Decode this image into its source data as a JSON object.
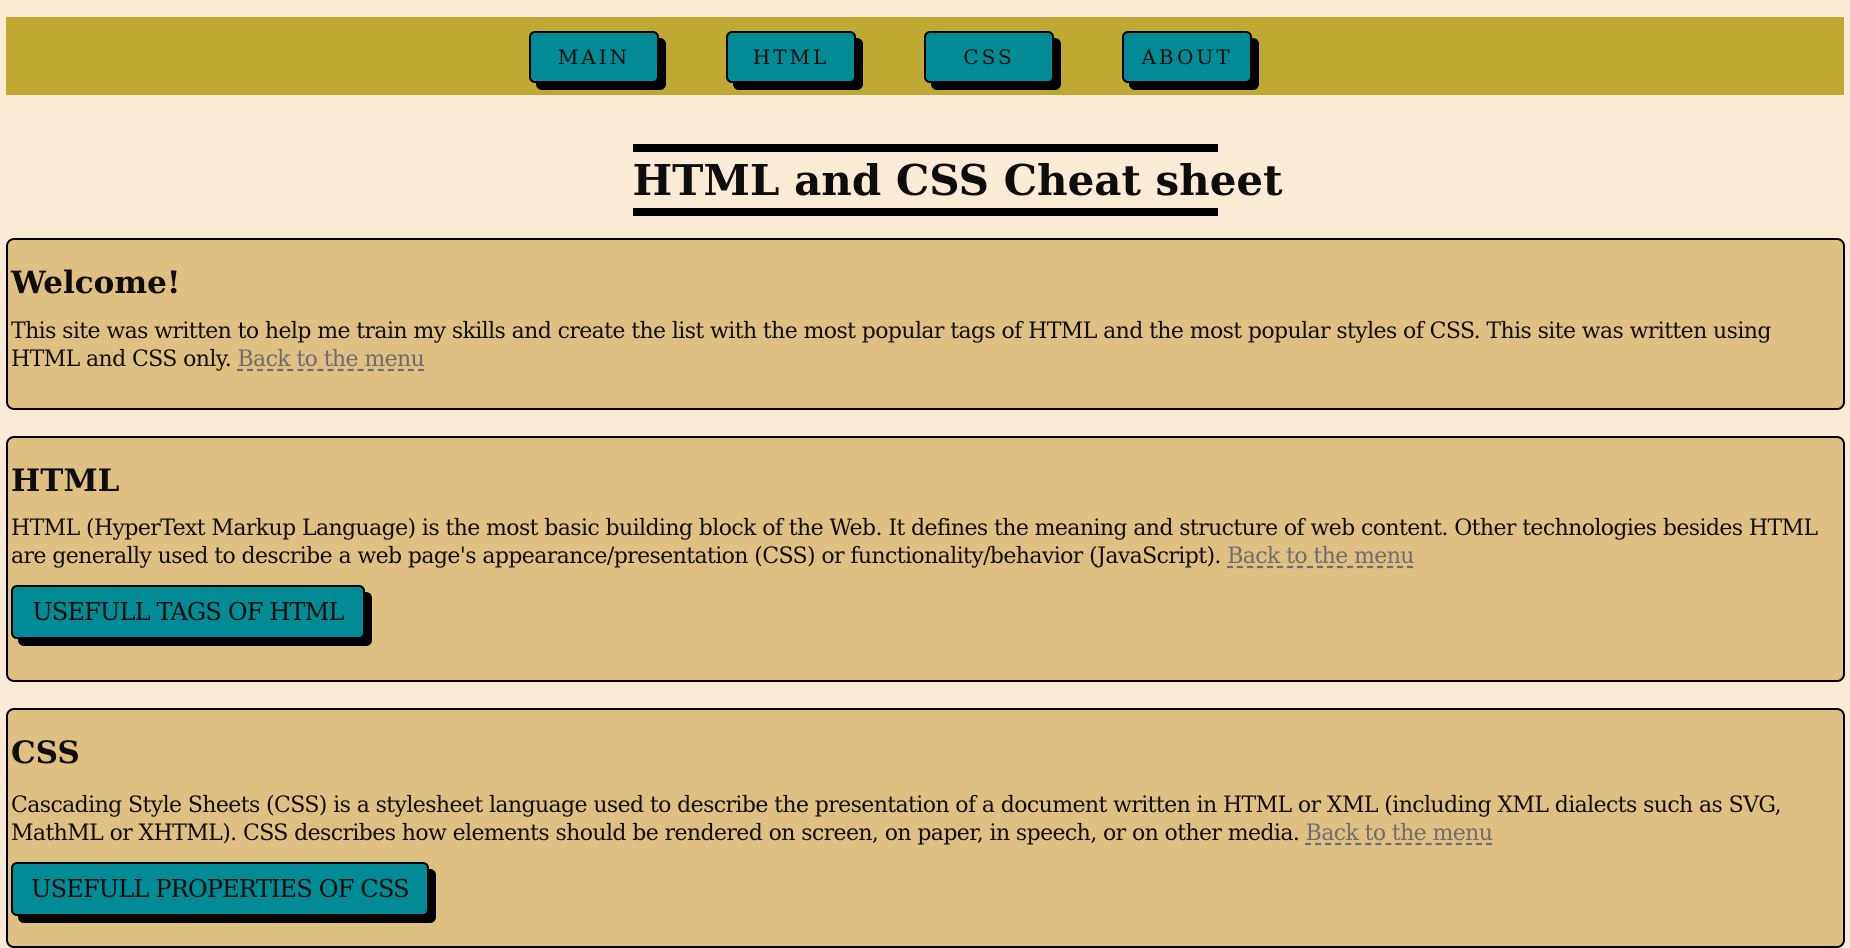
{
  "nav": {
    "items": [
      {
        "label": "MAIN"
      },
      {
        "label": "HTML"
      },
      {
        "label": "CSS"
      },
      {
        "label": "ABOUT"
      }
    ]
  },
  "title": "HTML and CSS Cheat sheet",
  "sections": {
    "welcome": {
      "heading": "Welcome!",
      "text": "This site was written to help me train my skills and create the list with the most popular tags of HTML and the most popular styles of CSS. This site was written using HTML and CSS only. ",
      "link": "Back to the menu"
    },
    "html": {
      "heading": "HTML",
      "text": "HTML (HyperText Markup Language) is the most basic building block of the Web. It defines the meaning and structure of web content. Other technologies besides HTML are generally used to describe a web page's appearance/presentation (CSS) or functionality/behavior (JavaScript). ",
      "link": "Back to the menu",
      "button": "USEFULL TAGS OF HTML"
    },
    "css": {
      "heading": "CSS",
      "text": "Cascading Style Sheets (CSS) is a stylesheet language used to describe the presentation of a document written in HTML or XML (including XML dialects such as SVG, MathML or XHTML). CSS describes how elements should be rendered on screen, on paper, in speech, or on other media. ",
      "link": "Back to the menu",
      "button": "USEFULL PROPERTIES OF CSS"
    }
  },
  "colors": {
    "background": "#faebd7",
    "nav_bar": "#c0a932",
    "button": "#008b96",
    "section": "#dfc083",
    "link": "#6e6e6e"
  }
}
